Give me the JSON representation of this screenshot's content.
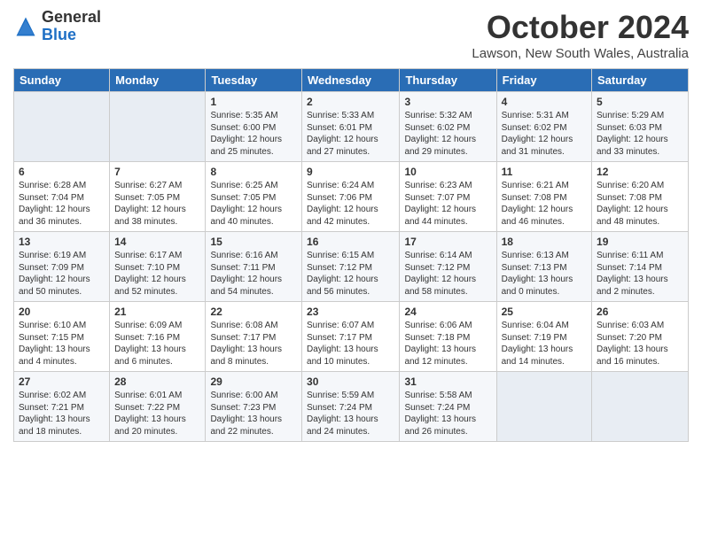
{
  "header": {
    "logo_general": "General",
    "logo_blue": "Blue",
    "month": "October 2024",
    "location": "Lawson, New South Wales, Australia"
  },
  "columns": [
    "Sunday",
    "Monday",
    "Tuesday",
    "Wednesday",
    "Thursday",
    "Friday",
    "Saturday"
  ],
  "weeks": [
    {
      "days": [
        {
          "num": "",
          "info": "",
          "empty": true
        },
        {
          "num": "",
          "info": "",
          "empty": true
        },
        {
          "num": "1",
          "info": "Sunrise: 5:35 AM\nSunset: 6:00 PM\nDaylight: 12 hours and 25 minutes."
        },
        {
          "num": "2",
          "info": "Sunrise: 5:33 AM\nSunset: 6:01 PM\nDaylight: 12 hours and 27 minutes."
        },
        {
          "num": "3",
          "info": "Sunrise: 5:32 AM\nSunset: 6:02 PM\nDaylight: 12 hours and 29 minutes."
        },
        {
          "num": "4",
          "info": "Sunrise: 5:31 AM\nSunset: 6:02 PM\nDaylight: 12 hours and 31 minutes."
        },
        {
          "num": "5",
          "info": "Sunrise: 5:29 AM\nSunset: 6:03 PM\nDaylight: 12 hours and 33 minutes."
        }
      ]
    },
    {
      "days": [
        {
          "num": "6",
          "info": "Sunrise: 6:28 AM\nSunset: 7:04 PM\nDaylight: 12 hours and 36 minutes."
        },
        {
          "num": "7",
          "info": "Sunrise: 6:27 AM\nSunset: 7:05 PM\nDaylight: 12 hours and 38 minutes."
        },
        {
          "num": "8",
          "info": "Sunrise: 6:25 AM\nSunset: 7:05 PM\nDaylight: 12 hours and 40 minutes."
        },
        {
          "num": "9",
          "info": "Sunrise: 6:24 AM\nSunset: 7:06 PM\nDaylight: 12 hours and 42 minutes."
        },
        {
          "num": "10",
          "info": "Sunrise: 6:23 AM\nSunset: 7:07 PM\nDaylight: 12 hours and 44 minutes."
        },
        {
          "num": "11",
          "info": "Sunrise: 6:21 AM\nSunset: 7:08 PM\nDaylight: 12 hours and 46 minutes."
        },
        {
          "num": "12",
          "info": "Sunrise: 6:20 AM\nSunset: 7:08 PM\nDaylight: 12 hours and 48 minutes."
        }
      ]
    },
    {
      "days": [
        {
          "num": "13",
          "info": "Sunrise: 6:19 AM\nSunset: 7:09 PM\nDaylight: 12 hours and 50 minutes."
        },
        {
          "num": "14",
          "info": "Sunrise: 6:17 AM\nSunset: 7:10 PM\nDaylight: 12 hours and 52 minutes."
        },
        {
          "num": "15",
          "info": "Sunrise: 6:16 AM\nSunset: 7:11 PM\nDaylight: 12 hours and 54 minutes."
        },
        {
          "num": "16",
          "info": "Sunrise: 6:15 AM\nSunset: 7:12 PM\nDaylight: 12 hours and 56 minutes."
        },
        {
          "num": "17",
          "info": "Sunrise: 6:14 AM\nSunset: 7:12 PM\nDaylight: 12 hours and 58 minutes."
        },
        {
          "num": "18",
          "info": "Sunrise: 6:13 AM\nSunset: 7:13 PM\nDaylight: 13 hours and 0 minutes."
        },
        {
          "num": "19",
          "info": "Sunrise: 6:11 AM\nSunset: 7:14 PM\nDaylight: 13 hours and 2 minutes."
        }
      ]
    },
    {
      "days": [
        {
          "num": "20",
          "info": "Sunrise: 6:10 AM\nSunset: 7:15 PM\nDaylight: 13 hours and 4 minutes."
        },
        {
          "num": "21",
          "info": "Sunrise: 6:09 AM\nSunset: 7:16 PM\nDaylight: 13 hours and 6 minutes."
        },
        {
          "num": "22",
          "info": "Sunrise: 6:08 AM\nSunset: 7:17 PM\nDaylight: 13 hours and 8 minutes."
        },
        {
          "num": "23",
          "info": "Sunrise: 6:07 AM\nSunset: 7:17 PM\nDaylight: 13 hours and 10 minutes."
        },
        {
          "num": "24",
          "info": "Sunrise: 6:06 AM\nSunset: 7:18 PM\nDaylight: 13 hours and 12 minutes."
        },
        {
          "num": "25",
          "info": "Sunrise: 6:04 AM\nSunset: 7:19 PM\nDaylight: 13 hours and 14 minutes."
        },
        {
          "num": "26",
          "info": "Sunrise: 6:03 AM\nSunset: 7:20 PM\nDaylight: 13 hours and 16 minutes."
        }
      ]
    },
    {
      "days": [
        {
          "num": "27",
          "info": "Sunrise: 6:02 AM\nSunset: 7:21 PM\nDaylight: 13 hours and 18 minutes."
        },
        {
          "num": "28",
          "info": "Sunrise: 6:01 AM\nSunset: 7:22 PM\nDaylight: 13 hours and 20 minutes."
        },
        {
          "num": "29",
          "info": "Sunrise: 6:00 AM\nSunset: 7:23 PM\nDaylight: 13 hours and 22 minutes."
        },
        {
          "num": "30",
          "info": "Sunrise: 5:59 AM\nSunset: 7:24 PM\nDaylight: 13 hours and 24 minutes."
        },
        {
          "num": "31",
          "info": "Sunrise: 5:58 AM\nSunset: 7:24 PM\nDaylight: 13 hours and 26 minutes."
        },
        {
          "num": "",
          "info": "",
          "empty": true
        },
        {
          "num": "",
          "info": "",
          "empty": true
        }
      ]
    }
  ]
}
